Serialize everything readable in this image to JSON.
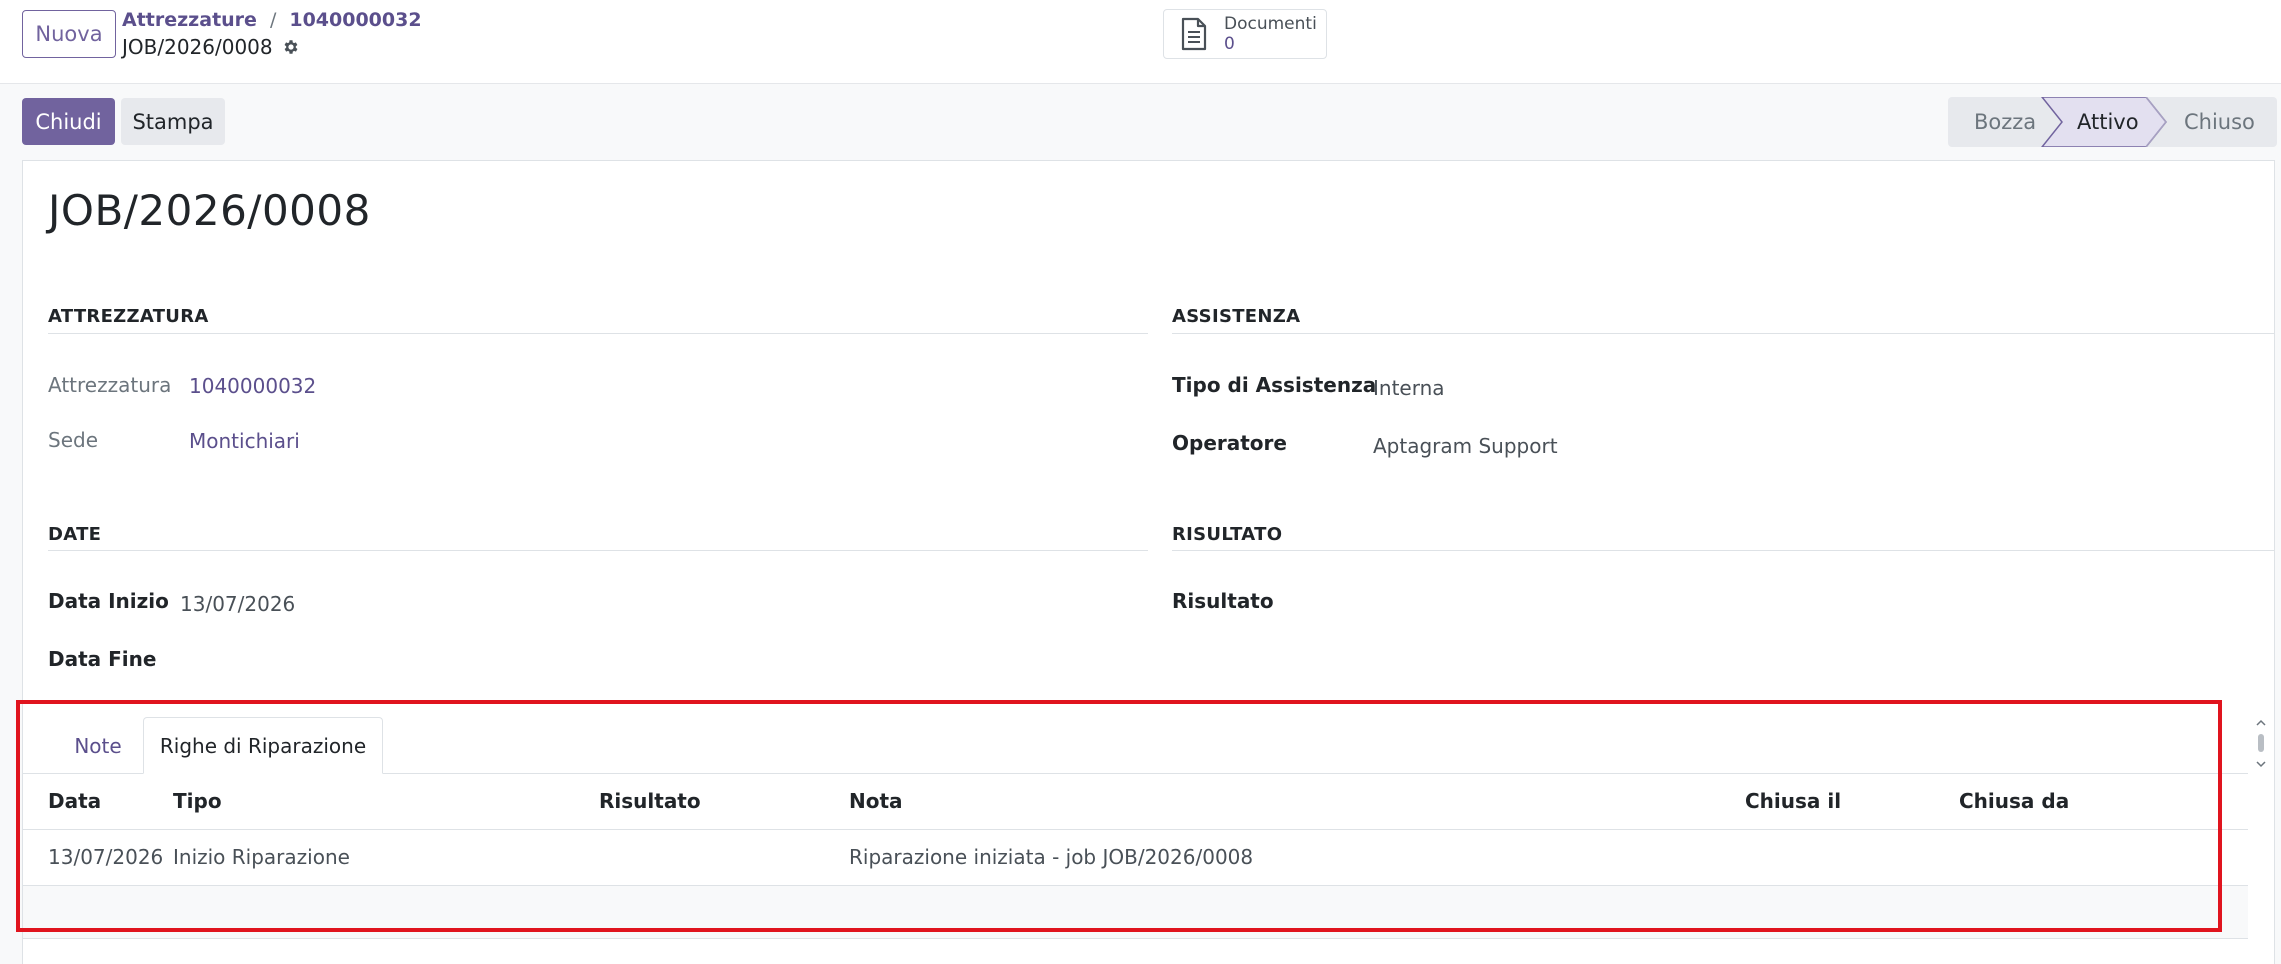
{
  "topbar": {
    "new_label": "Nuova",
    "breadcrumb": {
      "parent": "Attrezzature",
      "separator": "/",
      "current": "1040000032"
    },
    "record_name": "JOB/2026/0008",
    "documents": {
      "label": "Documenti",
      "count": "0"
    }
  },
  "actions": {
    "close_label": "Chiudi",
    "print_label": "Stampa"
  },
  "status": {
    "steps": [
      "Bozza",
      "Attivo",
      "Chiuso"
    ],
    "active": "Attivo"
  },
  "form": {
    "title": "JOB/2026/0008",
    "equipment_group": {
      "title": "ATTREZZATURA",
      "equipment_label": "Attrezzatura",
      "equipment_value": "1040000032",
      "site_label": "Sede",
      "site_value": "Montichiari"
    },
    "assistance_group": {
      "title": "ASSISTENZA",
      "type_label": "Tipo di Assistenza",
      "type_value": "Interna",
      "operator_label": "Operatore",
      "operator_value": "Aptagram Support"
    },
    "dates_group": {
      "title": "DATE",
      "start_label": "Data Inizio",
      "start_value": "13/07/2026",
      "end_label": "Data Fine"
    },
    "result_group": {
      "title": "RISULTATO",
      "result_label": "Risultato"
    }
  },
  "notebook": {
    "tabs": [
      "Note",
      "Righe di Riparazione"
    ],
    "active_tab": "Righe di Riparazione",
    "columns": [
      "Data",
      "Tipo",
      "Risultato",
      "Nota",
      "Chiusa il",
      "Chiusa da"
    ],
    "rows": [
      {
        "data": "13/07/2026",
        "tipo": "Inizio Riparazione",
        "risultato": "",
        "nota": "Riparazione iniziata - job JOB/2026/0008",
        "chiusa_il": "",
        "chiusa_da": ""
      }
    ]
  },
  "colors": {
    "primary": "#71639e",
    "link": "#5b4f8c",
    "highlight": "#e0141e"
  }
}
